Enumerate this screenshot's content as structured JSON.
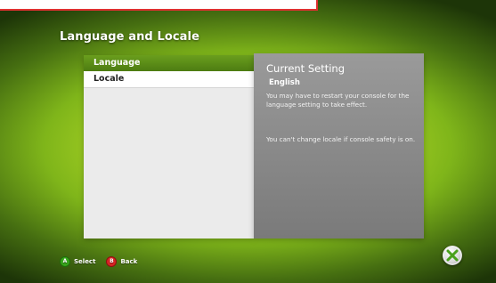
{
  "screen": {
    "title": "Language and Locale"
  },
  "menu": {
    "items": [
      {
        "label": "Language",
        "selected": true
      },
      {
        "label": "Locale",
        "selected": false
      }
    ]
  },
  "panel": {
    "heading": "Current Setting",
    "value": "English",
    "note1": "You may have to restart your console for the language setting to take effect.",
    "note2": "You can't change locale if console safety is on."
  },
  "footer": {
    "select": {
      "button": "A",
      "label": "Select"
    },
    "back": {
      "button": "B",
      "label": "Back"
    }
  },
  "colors": {
    "accent_green": "#5f951b",
    "button_a": "#37a51b",
    "button_b": "#d82424"
  },
  "icons": {
    "logo": "xbox-logo-icon"
  }
}
